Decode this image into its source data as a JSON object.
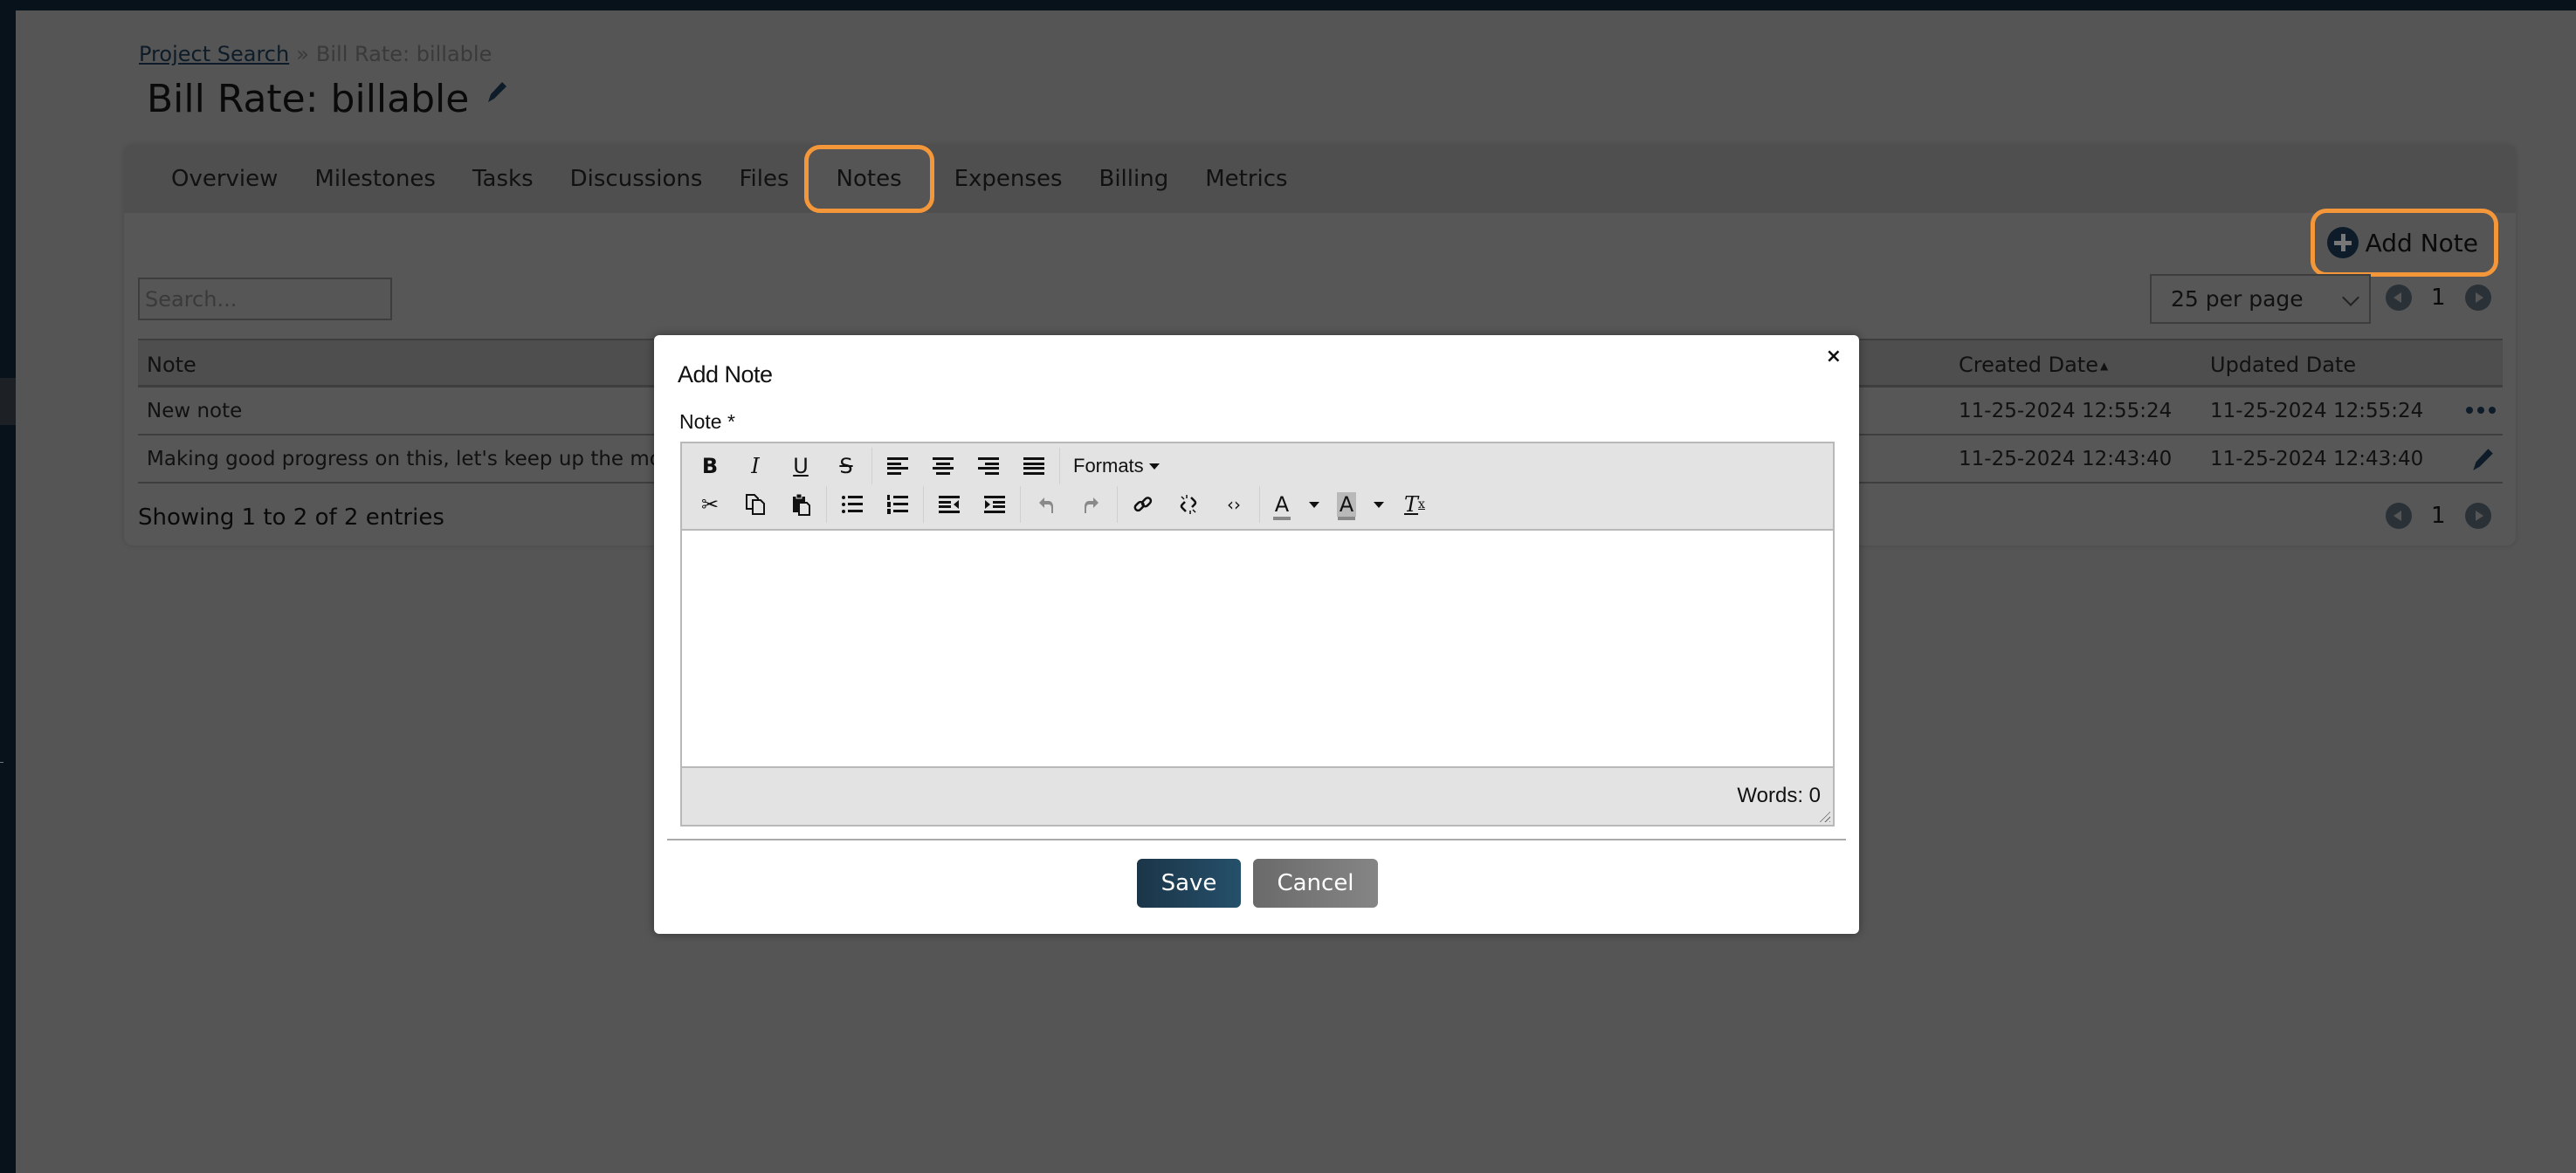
{
  "breadcrumb": {
    "link": "Project Search",
    "separator": "»",
    "current": "Bill Rate: billable"
  },
  "page_title": "Bill Rate: billable",
  "tabs": [
    {
      "label": "Overview",
      "active": false
    },
    {
      "label": "Milestones",
      "active": false
    },
    {
      "label": "Tasks",
      "active": false
    },
    {
      "label": "Discussions",
      "active": false
    },
    {
      "label": "Files",
      "active": false
    },
    {
      "label": "Notes",
      "active": true
    },
    {
      "label": "Expenses",
      "active": false
    },
    {
      "label": "Billing",
      "active": false
    },
    {
      "label": "Metrics",
      "active": false
    }
  ],
  "add_note_button": "Add Note",
  "search": {
    "placeholder": "Search...",
    "value": ""
  },
  "per_page": {
    "selected": "25 per page"
  },
  "pagination": {
    "current_page": "1"
  },
  "table": {
    "columns": {
      "note": "Note",
      "created": "Created Date",
      "created_sort_indicator": "▲",
      "updated": "Updated Date"
    },
    "rows": [
      {
        "note": "New note",
        "created": "11-25-2024 12:55:24",
        "updated": "11-25-2024 12:55:24",
        "action": "more-icon"
      },
      {
        "note": "Making good progress on this, let's keep up the momentu",
        "created": "11-25-2024 12:43:40",
        "updated": "11-25-2024 12:43:40",
        "action": "edit-icon"
      }
    ]
  },
  "showing_text": "Showing 1 to 2 of 2 entries",
  "modal": {
    "title": "Add Note",
    "close_label": "×",
    "field_label": "Note *",
    "editor": {
      "toolbar_row1": [
        "bold",
        "italic",
        "underline",
        "strikethrough",
        "align-left",
        "align-center",
        "align-right",
        "align-justify"
      ],
      "formats_label": "Formats",
      "toolbar_row2": [
        "cut",
        "copy",
        "paste",
        "bullet-list",
        "numbered-list",
        "outdent",
        "indent",
        "undo",
        "redo",
        "link",
        "unlink",
        "code",
        "text-color",
        "background-color",
        "clear-formatting"
      ],
      "content": "",
      "word_count": "Words: 0"
    },
    "save_label": "Save",
    "cancel_label": "Cancel"
  },
  "colors": {
    "highlight_ring": "#f3973a",
    "primary_button": "#1f435b",
    "secondary_button": "#777777",
    "brand_dark": "#0d1c28"
  }
}
